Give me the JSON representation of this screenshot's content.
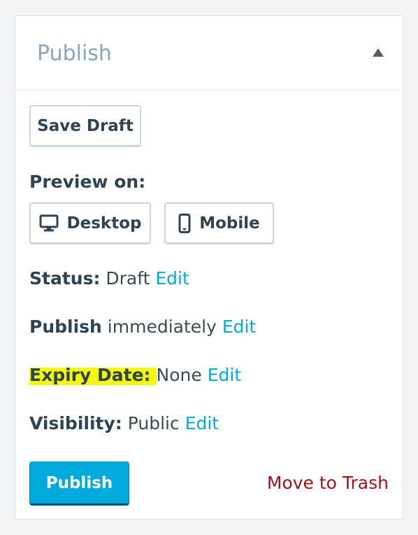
{
  "panel": {
    "title": "Publish",
    "collapse_icon": "triangle-up-icon"
  },
  "actions": {
    "save_draft_label": "Save Draft"
  },
  "preview": {
    "label": "Preview on:",
    "desktop_label": "Desktop",
    "desktop_icon": "desktop-monitor-icon",
    "mobile_label": "Mobile",
    "mobile_icon": "mobile-phone-icon"
  },
  "status": {
    "key": "Status:",
    "value": "Draft",
    "edit_label": "Edit"
  },
  "publish_schedule": {
    "key": "Publish",
    "value": "immediately",
    "edit_label": "Edit"
  },
  "expiry": {
    "key": "Expiry Date:",
    "value": "None",
    "edit_label": "Edit",
    "highlight_color": "#f6f80a"
  },
  "visibility": {
    "key": "Visibility:",
    "value": "Public",
    "edit_label": "Edit"
  },
  "footer": {
    "publish_label": "Publish",
    "trash_label": "Move to Trash"
  },
  "colors": {
    "accent": "#00aadc",
    "danger": "#a0121a",
    "title": "#87a6bc",
    "text": "#2e4453"
  }
}
